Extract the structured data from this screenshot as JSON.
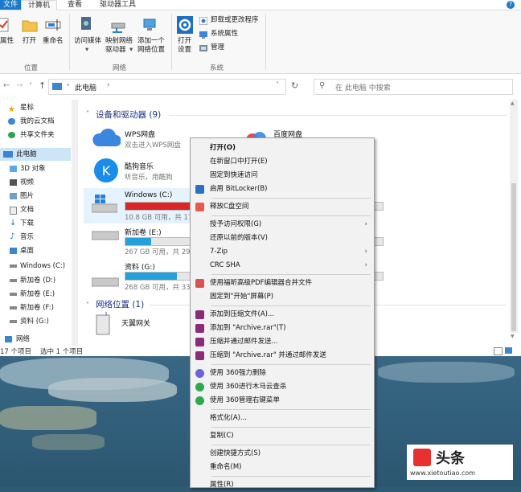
{
  "ribbon": {
    "tabs": [
      "文件",
      "计算机",
      "查看",
      "驱动器工具"
    ],
    "groups": {
      "location": {
        "label": "位置",
        "buttons": [
          "属性",
          "打开",
          "重命名"
        ]
      },
      "network": {
        "label": "网络",
        "buttons": [
          {
            "line1": "访问媒体",
            "line2": ""
          },
          {
            "line1": "映射网络",
            "line2": "驱动器"
          },
          {
            "line1": "添加一个",
            "line2": "网络位置"
          }
        ]
      },
      "system": {
        "label": "系统",
        "open_settings": {
          "line1": "打开",
          "line2": "设置"
        },
        "items": [
          "卸载或更改程序",
          "系统属性",
          "管理"
        ]
      }
    }
  },
  "address": {
    "path": "此电脑",
    "search_placeholder": "在 此电脑 中搜索"
  },
  "nav": {
    "items": [
      {
        "label": "星标",
        "icon": "star-icon"
      },
      {
        "label": "我的云文档",
        "icon": "cloud-icon"
      },
      {
        "label": "共享文件夹",
        "icon": "share-icon"
      },
      {
        "label": "此电脑",
        "icon": "computer-icon",
        "selected": true
      },
      {
        "label": "3D 对象",
        "icon": "cube-icon"
      },
      {
        "label": "视频",
        "icon": "video-icon"
      },
      {
        "label": "图片",
        "icon": "picture-icon"
      },
      {
        "label": "文档",
        "icon": "document-icon"
      },
      {
        "label": "下载",
        "icon": "download-icon"
      },
      {
        "label": "音乐",
        "icon": "music-icon"
      },
      {
        "label": "桌面",
        "icon": "desktop-icon"
      },
      {
        "label": "Windows (C:)",
        "icon": "drive-icon"
      },
      {
        "label": "新加卷 (D:)",
        "icon": "drive-icon"
      },
      {
        "label": "新加卷 (E:)",
        "icon": "drive-icon"
      },
      {
        "label": "新加卷 (F:)",
        "icon": "drive-icon"
      },
      {
        "label": "资料 (G:)",
        "icon": "drive-icon"
      },
      {
        "label": "网络",
        "icon": "network-icon"
      }
    ]
  },
  "content": {
    "devices_header": "设备和驱动器 (9)",
    "network_header": "网络位置 (1)",
    "items": [
      {
        "name": "WPS网盘",
        "sub": "双击进入WPS网盘"
      },
      {
        "name": "百度网盘",
        "sub": ""
      },
      {
        "name": "酷狗音乐",
        "sub": "听音乐，用酷狗"
      },
      {
        "name": "Windows (C:)",
        "sub": "10.8 GB 可用，共 17",
        "fill": 0.9
      },
      {
        "name": "新加卷 (E:)",
        "sub": "267 GB 可用，共 29",
        "fill": 0.1
      },
      {
        "name": "资料 (G:)",
        "sub": "268 GB 可用，共 33",
        "fill": 0.2
      }
    ],
    "network_items": [
      {
        "name": "天翼网关"
      }
    ]
  },
  "status": {
    "count": "17 个项目",
    "selected": "选中 1 个项目"
  },
  "context_menu": {
    "items": [
      {
        "label": "打开(O)",
        "bold": true
      },
      {
        "label": "在新窗口中打开(E)"
      },
      {
        "label": "固定到快速访问"
      },
      {
        "label": "启用 BitLocker(B)",
        "icon": "shield-icon"
      },
      {
        "sep": true
      },
      {
        "label": "释放C盘空间",
        "icon": "cleanup-icon"
      },
      {
        "sep": true
      },
      {
        "label": "授予访问权限(G)",
        "arrow": true
      },
      {
        "label": "还原以前的版本(V)"
      },
      {
        "label": "7-Zip",
        "arrow": true
      },
      {
        "label": "CRC SHA",
        "arrow": true
      },
      {
        "sep": true
      },
      {
        "label": "使用福昕高级PDF编辑器合并文件",
        "icon": "pdf-icon"
      },
      {
        "label": "固定到\"开始\"屏幕(P)"
      },
      {
        "sep": true
      },
      {
        "label": "添加到压缩文件(A)...",
        "icon": "winrar-icon"
      },
      {
        "label": "添加到 \"Archive.rar\"(T)",
        "icon": "winrar-icon"
      },
      {
        "label": "压缩并通过邮件发送...",
        "icon": "winrar-icon"
      },
      {
        "label": "压缩到 \"Archive.rar\" 并通过邮件发送",
        "icon": "winrar-icon"
      },
      {
        "sep": true
      },
      {
        "label": "使用 360强力删除",
        "icon": "360-delete-icon"
      },
      {
        "label": "使用 360进行木马云查杀",
        "icon": "360-scan-icon"
      },
      {
        "label": "使用 360管理右键菜单",
        "icon": "360-menu-icon"
      },
      {
        "sep": true
      },
      {
        "label": "格式化(A)..."
      },
      {
        "sep": true
      },
      {
        "label": "复制(C)"
      },
      {
        "sep": true
      },
      {
        "label": "创建快捷方式(S)"
      },
      {
        "label": "重命名(M)"
      },
      {
        "sep": true
      },
      {
        "label": "属性(R)"
      }
    ]
  },
  "watermark": {
    "brand": "头条",
    "site": "www.xietoutiao.com"
  },
  "colors": {
    "accent": "#1979ca",
    "bar_normal": "#26a0da",
    "bar_full": "#da2626",
    "selection": "#cde6f7"
  }
}
